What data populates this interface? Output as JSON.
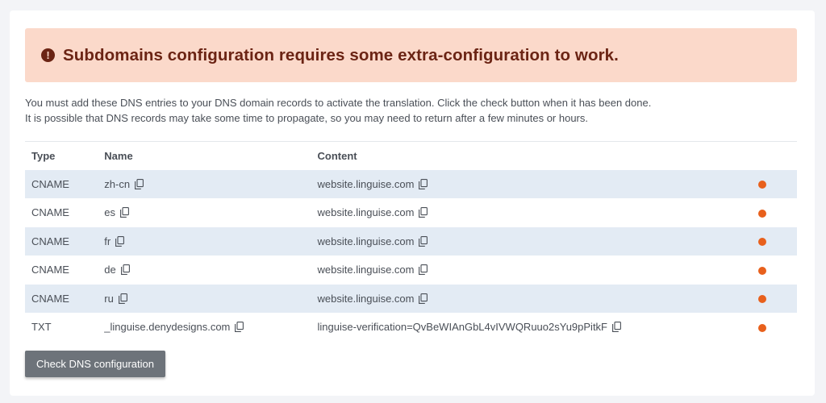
{
  "alert": {
    "icon": "exclamation-circle-icon",
    "text": "Subdomains configuration requires some extra-configuration to work."
  },
  "description": {
    "line1": "You must add these DNS entries to your DNS domain records to activate the translation. Click the check button when it has been done.",
    "line2": "It is possible that DNS records may take some time to propagate, so you may need to return after a few minutes or hours."
  },
  "table": {
    "headers": {
      "type": "Type",
      "name": "Name",
      "content": "Content"
    },
    "rows": [
      {
        "type": "CNAME",
        "name": "zh-cn",
        "content": "website.linguise.com",
        "status": "pending"
      },
      {
        "type": "CNAME",
        "name": "es",
        "content": "website.linguise.com",
        "status": "pending"
      },
      {
        "type": "CNAME",
        "name": "fr",
        "content": "website.linguise.com",
        "status": "pending"
      },
      {
        "type": "CNAME",
        "name": "de",
        "content": "website.linguise.com",
        "status": "pending"
      },
      {
        "type": "CNAME",
        "name": "ru",
        "content": "website.linguise.com",
        "status": "pending"
      },
      {
        "type": "TXT",
        "name": "_linguise.denydesigns.com",
        "content": "linguise-verification=QvBeWIAnGbL4vIVWQRuuo2sYu9pPitkF",
        "status": "pending"
      }
    ],
    "copy_icon": "copy-icon",
    "status_color": "#e8601c"
  },
  "button": {
    "label": "Check DNS configuration"
  },
  "colors": {
    "alert_bg": "#fbd9ca",
    "alert_text": "#6b2414",
    "row_stripe": "#e3ebf4",
    "button_bg": "#6d737a"
  }
}
